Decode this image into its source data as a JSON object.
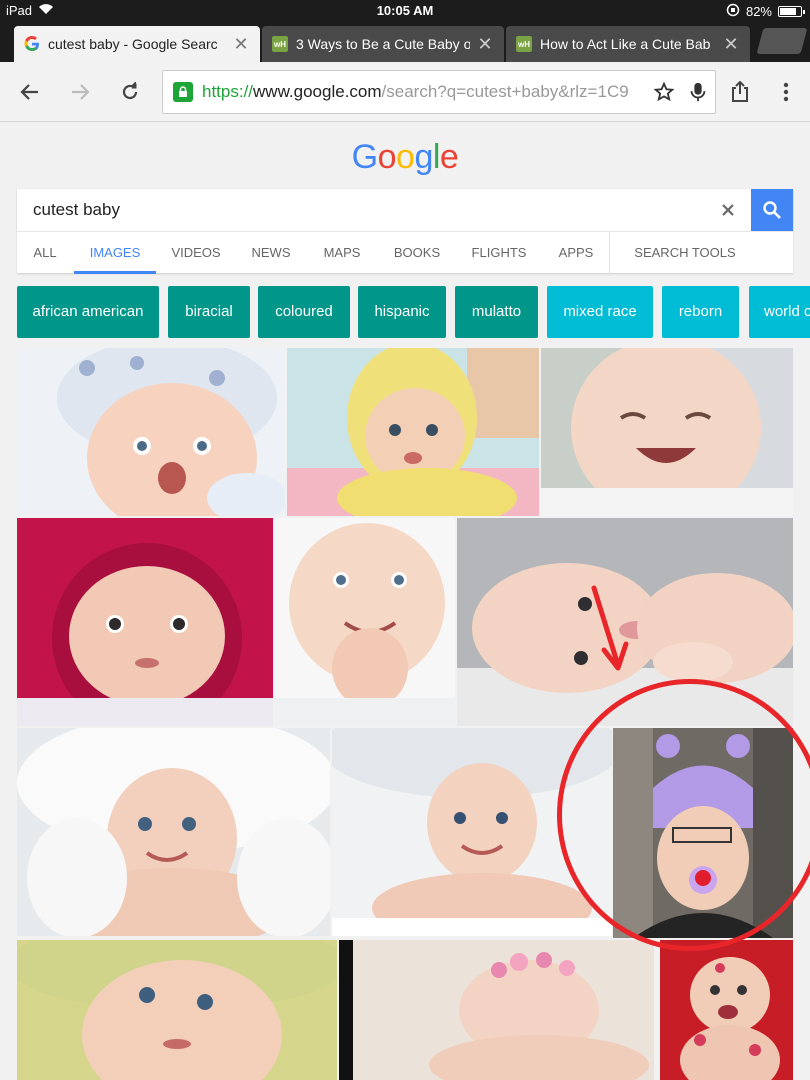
{
  "status_bar": {
    "device": "iPad",
    "time": "10:05 AM",
    "battery_text": "82%",
    "battery_level": 0.82
  },
  "tabs": [
    {
      "favicon": "G",
      "favicon_name": "google-favicon-icon",
      "title": "cutest baby - Google Searc",
      "active": true
    },
    {
      "favicon": "wH",
      "favicon_name": "wikihow-favicon-icon",
      "title": "3 Ways to Be a Cute Baby o",
      "active": false
    },
    {
      "favicon": "wH",
      "favicon_name": "wikihow-favicon-icon",
      "title": "How to Act Like a Cute Bab",
      "active": false
    }
  ],
  "omnibox": {
    "scheme": "https://",
    "host": "www.google.com",
    "path": "/search?q=cutest+baby&rlz=1C9"
  },
  "google": {
    "logo_letters": [
      "G",
      "o",
      "o",
      "g",
      "l",
      "e"
    ],
    "query": "cutest baby",
    "nav_tabs": [
      "ALL",
      "IMAGES",
      "VIDEOS",
      "NEWS",
      "MAPS",
      "BOOKS",
      "FLIGHTS",
      "APPS"
    ],
    "search_tools": "SEARCH TOOLS",
    "chips": [
      "african american",
      "biracial",
      "coloured",
      "hispanic",
      "mulatto",
      "mixed race",
      "reborn",
      "world c"
    ],
    "colors": {
      "chip_dark": "#00978a",
      "chip_light": "#00bcd4",
      "accent": "#4285f4",
      "annotation": "#e8262a"
    }
  }
}
